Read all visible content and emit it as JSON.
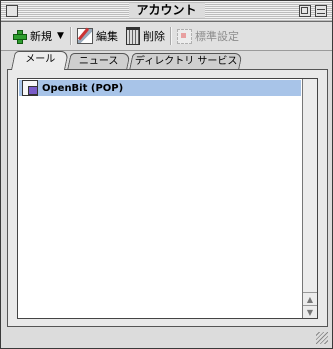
{
  "window": {
    "title": "アカウント"
  },
  "toolbar": {
    "new_label": "新規",
    "edit_label": "編集",
    "delete_label": "削除",
    "default_label": "標準設定"
  },
  "tabs": [
    {
      "label": "メール",
      "active": true
    },
    {
      "label": "ニュース",
      "active": false
    },
    {
      "label": "ディレクトリ サービス",
      "active": false
    }
  ],
  "accounts": [
    {
      "name": "OpenBit (POP)",
      "selected": true,
      "icon": "mail-account-icon"
    }
  ],
  "colors": {
    "selection": "#a8c4e8",
    "new_icon": "#2e9d2e"
  }
}
